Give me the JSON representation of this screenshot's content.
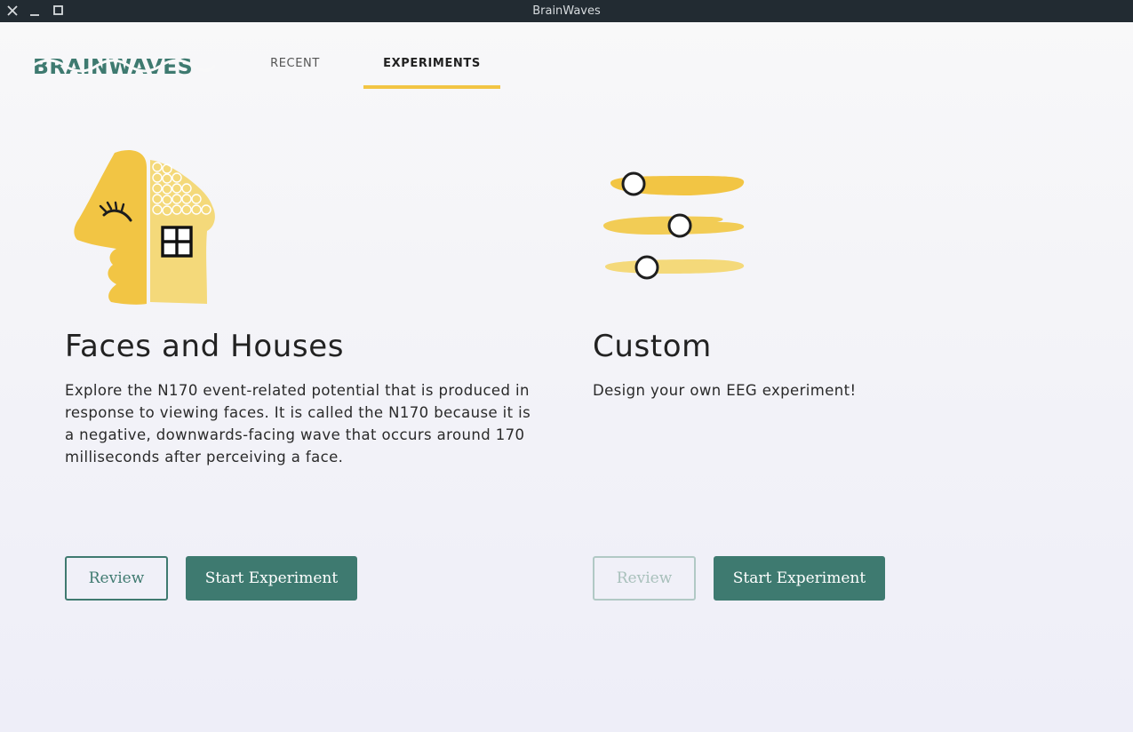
{
  "window": {
    "title": "BrainWaves"
  },
  "brand": {
    "logo_text": "BRAINWAVES",
    "color": "#3e7a70"
  },
  "nav": {
    "tabs": [
      {
        "label": "RECENT",
        "active": false
      },
      {
        "label": "EXPERIMENTS",
        "active": true
      }
    ],
    "active_underline_color": "#f2c544"
  },
  "experiments": [
    {
      "title": "Faces and Houses",
      "description": "Explore the N170 event-related potential that is produced in response to viewing faces. It is called the N170 because it is a negative, downwards-facing wave that occurs around 170 milliseconds after perceiving a face.",
      "icon": "faces-houses-icon",
      "review_label": "Review",
      "review_enabled": true,
      "start_label": "Start Experiment"
    },
    {
      "title": "Custom",
      "description": "Design your own EEG experiment!",
      "icon": "sliders-icon",
      "review_label": "Review",
      "review_enabled": false,
      "start_label": "Start Experiment"
    }
  ],
  "colors": {
    "accent_yellow": "#f2c544",
    "primary_green": "#3e7a70",
    "titlebar": "#222b32"
  }
}
